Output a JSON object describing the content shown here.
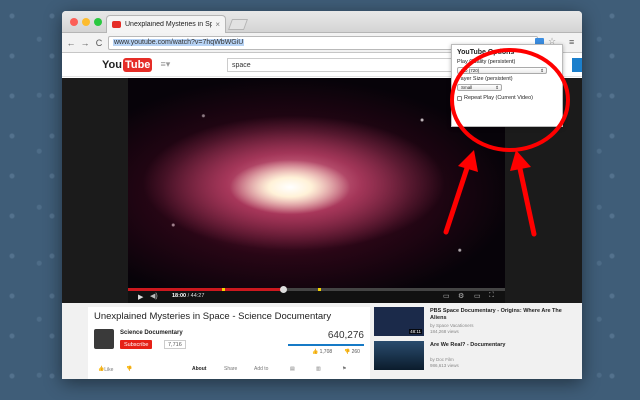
{
  "browser": {
    "tab_title": "Unexplained Mysteries in Space",
    "tab_close": "×",
    "back": "←",
    "forward": "→",
    "reload": "C",
    "url_host": "www.youtube.com",
    "url_path": "/watch?v=7hqWbWGiU",
    "star": "☆",
    "menu": "≡"
  },
  "youtube": {
    "logo_you": "You",
    "logo_tube": "Tube",
    "guide_icon": "≡▾",
    "search_value": "space"
  },
  "player": {
    "current_time": "18:00",
    "total_time": "/ 44:27",
    "progress_fraction": 0.41,
    "play_icon": "▶",
    "volume_icon": "◀)",
    "settings_icon": "⚙",
    "cc_icon": "▭",
    "fullscreen_icon": "⛶",
    "theater_icon": "▭"
  },
  "video_info": {
    "title": "Unexplained Mysteries in Space - Science Documentary",
    "channel": "Science Documentary",
    "subscribe_label": "Subscribe",
    "subscriber_count": "7,716",
    "views": "640,276",
    "likes": "1,708",
    "dislikes": "260",
    "actions": {
      "like": "Like",
      "about": "About",
      "share": "Share",
      "add_to": "Add to"
    }
  },
  "related": [
    {
      "title": "PBS Space Documentary - Origins: Where Are The Aliens",
      "by": "by Space Vacationers",
      "views": "184,268 views",
      "duration": "48:11"
    },
    {
      "title": "Are We Real? - Documentary",
      "by": "by Doc Film",
      "views": "986,613 views",
      "duration": ""
    }
  ],
  "extension_popup": {
    "title": "YouTube Options",
    "quality_label": "Play Quality (persistent)",
    "quality_value": "HD (720)",
    "size_label": "Payer Size (persistent)",
    "size_value": "Small",
    "repeat_label": "Repeat Play (Current Video)",
    "select_arrow": "⇕"
  },
  "colors": {
    "youtube_red": "#e52d27",
    "annotation_red": "#ff0000",
    "progress_red": "#cc181e"
  }
}
